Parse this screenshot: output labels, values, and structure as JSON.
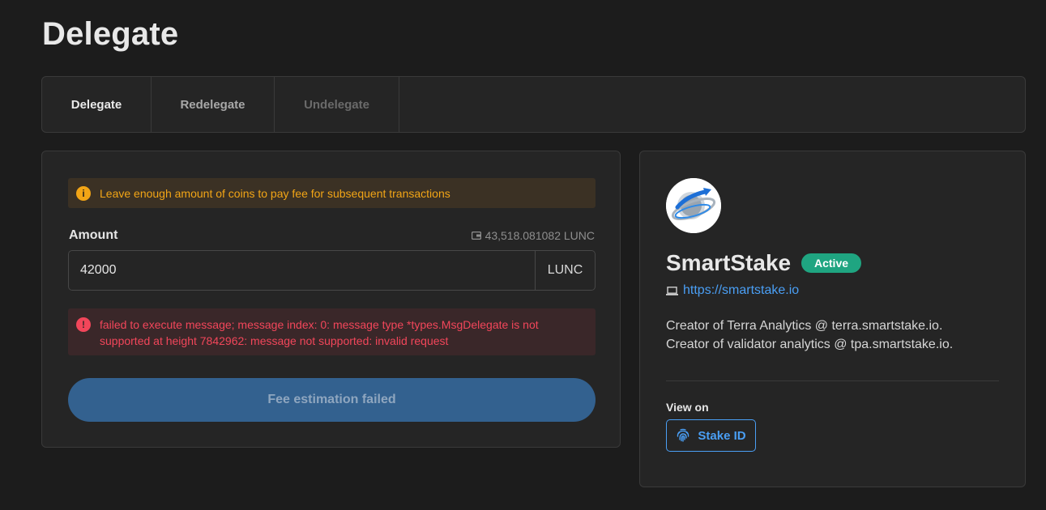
{
  "page": {
    "title": "Delegate"
  },
  "tabs": [
    {
      "label": "Delegate",
      "state": "active"
    },
    {
      "label": "Redelegate",
      "state": "normal"
    },
    {
      "label": "Undelegate",
      "state": "disabled"
    }
  ],
  "form": {
    "warning": {
      "icon": "info-icon",
      "text": "Leave enough amount of coins to pay fee for subsequent transactions"
    },
    "amount_label": "Amount",
    "balance": {
      "icon": "wallet-icon",
      "text": "43,518.081082 LUNC"
    },
    "amount_value": "42000",
    "amount_unit": "LUNC",
    "error": {
      "icon": "error-icon",
      "line1": "failed to execute message; message index: 0: message type *types.MsgDelegate is not",
      "line2": "supported at height 7842962: message not supported: invalid request"
    },
    "submit_label": "Fee estimation failed"
  },
  "validator": {
    "name": "SmartStake",
    "status": "Active",
    "website_icon": "laptop-icon",
    "website": "https://smartstake.io",
    "description_line1": "Creator of Terra Analytics @ terra.smartstake.io.",
    "description_line2": "Creator of validator analytics @ tpa.smartstake.io.",
    "view_on_label": "View on",
    "stakeid": {
      "icon": "fingerprint-icon",
      "label": "Stake ID"
    }
  },
  "colors": {
    "background": "#1c1c1c",
    "card": "#252525",
    "warning": "#f2a516",
    "error": "#f2465a",
    "primary_button": "#33618f",
    "link": "#4a9ff5",
    "active_badge": "#1fa581"
  }
}
